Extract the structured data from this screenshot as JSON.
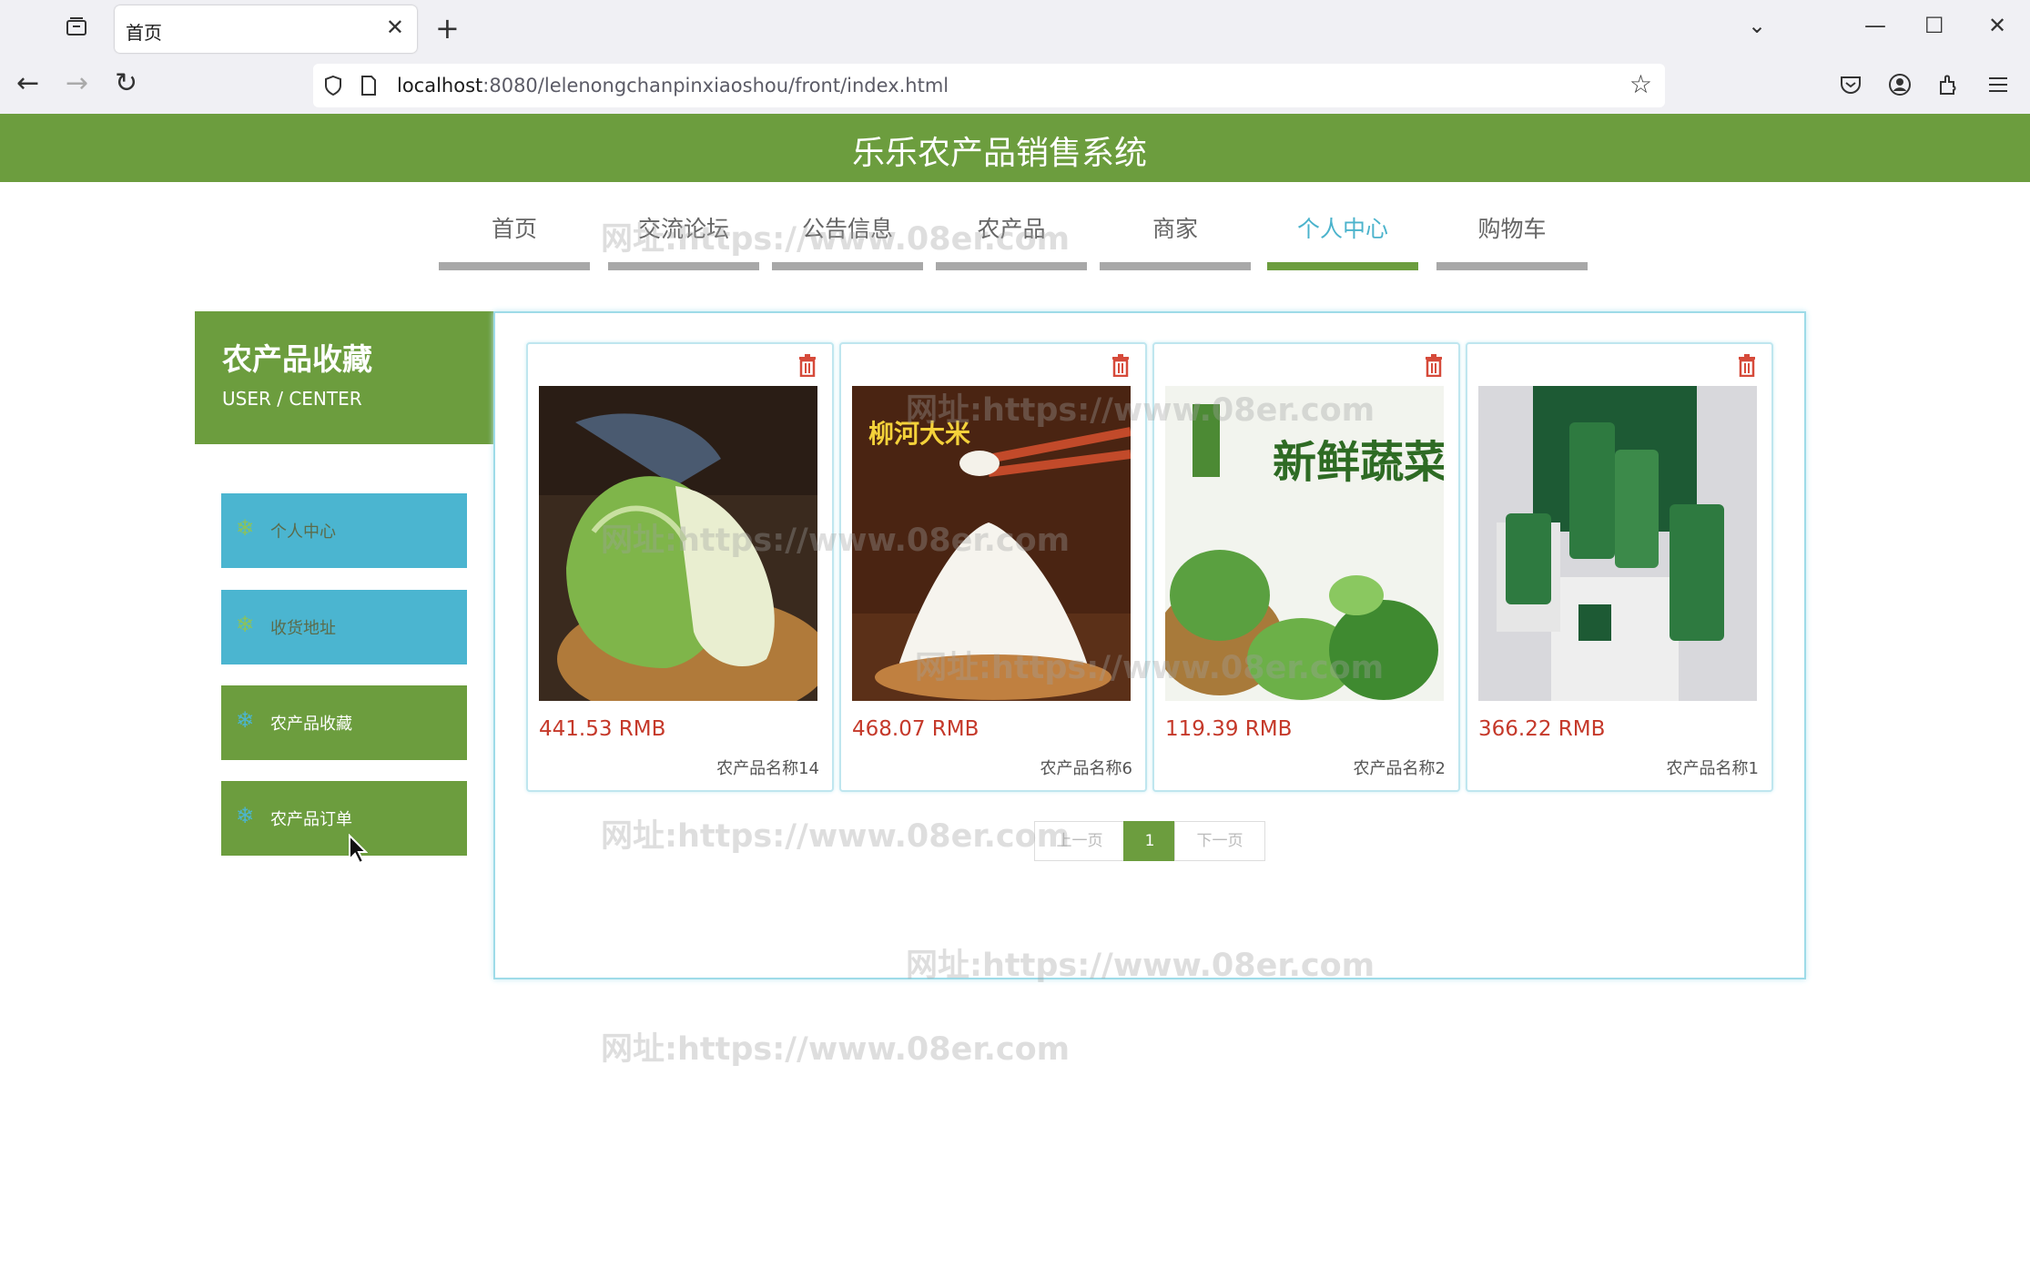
{
  "browser": {
    "tab_title": "首页",
    "url_host": "localhost",
    "url_rest": ":8080/lelenongchanpinxiaoshou/front/index.html"
  },
  "site": {
    "title": "乐乐农产品销售系统"
  },
  "nav": {
    "items": [
      "首页",
      "交流论坛",
      "公告信息",
      "农产品",
      "商家",
      "个人中心",
      "购物车"
    ],
    "active": "个人中心"
  },
  "sidebar": {
    "title": "农产品收藏",
    "subtitle": "USER / CENTER",
    "items": [
      "个人中心",
      "收货地址",
      "农产品收藏",
      "农产品订单"
    ]
  },
  "products": [
    {
      "price": "441.53 RMB",
      "name": "农产品名称14"
    },
    {
      "price": "468.07 RMB",
      "name": "农产品名称6"
    },
    {
      "price": "119.39 RMB",
      "name": "农产品名称2"
    },
    {
      "price": "366.22 RMB",
      "name": "农产品名称1"
    }
  ],
  "images": {
    "rice_label": "柳河大米",
    "veg_label": "新鲜蔬菜"
  },
  "pagination": {
    "prev": "上一页",
    "current": "1",
    "next": "下一页"
  },
  "watermark": "网址:https://www.08er.com",
  "colors": {
    "header_green": "#6c9d3e",
    "accent_blue": "#4bb5d0",
    "price_red": "#c5392a"
  }
}
